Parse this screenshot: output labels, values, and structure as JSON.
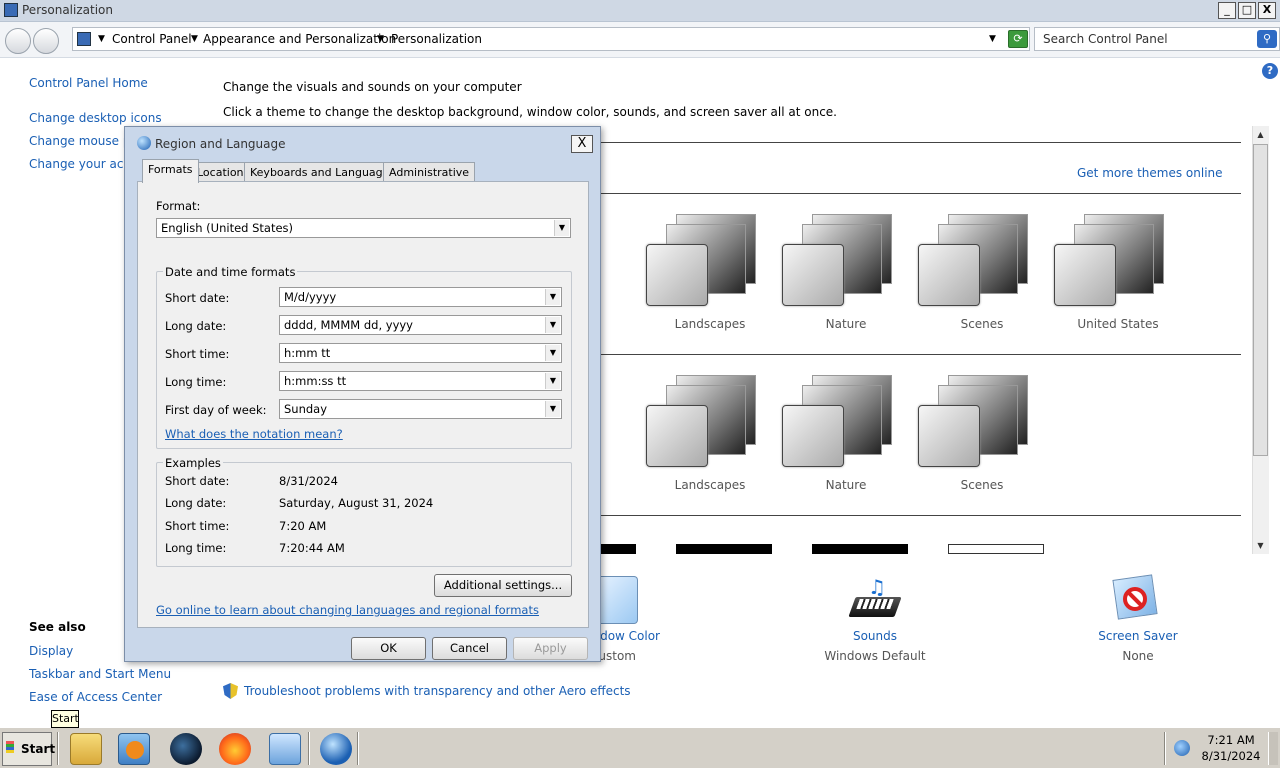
{
  "window": {
    "title": "Personalization",
    "minimize": "_",
    "maximize": "□",
    "close": "X"
  },
  "address": {
    "crumbs": [
      "Control Panel",
      "Appearance and Personalization",
      "Personalization"
    ],
    "search_placeholder": "Search Control Panel"
  },
  "sidebar": {
    "home": "Control Panel Home",
    "links": [
      "Change desktop icons",
      "Change mouse pointers",
      "Change your account picture"
    ],
    "see_also_title": "See also",
    "see_also": [
      "Display",
      "Taskbar and Start Menu",
      "Ease of Access Center"
    ]
  },
  "main": {
    "heading": "Change the visuals and sounds on your computer",
    "subheading": "Click a theme to change the desktop background, window color, sounds, and screen saver all at once.",
    "get_more_themes": "Get more themes online",
    "row1_themes": [
      "Landscapes",
      "Nature",
      "Scenes",
      "United States"
    ],
    "row2_themes": [
      "Landscapes",
      "Nature",
      "Scenes"
    ],
    "bottom": {
      "window_color_label": "Window Color",
      "window_color_value": "Custom",
      "sounds_label": "Sounds",
      "sounds_value": "Windows Default",
      "screensaver_label": "Screen Saver",
      "screensaver_value": "None"
    },
    "troubleshoot": "Troubleshoot problems with transparency and other Aero effects"
  },
  "dialog": {
    "title": "Region and Language",
    "close": "X",
    "tabs": [
      "Formats",
      "Location",
      "Keyboards and Languages",
      "Administrative"
    ],
    "format_label": "Format:",
    "format_value": "English (United States)",
    "dt_group": "Date and time formats",
    "fields": [
      {
        "label": "Short date:",
        "value": "M/d/yyyy"
      },
      {
        "label": "Long date:",
        "value": "dddd, MMMM dd, yyyy"
      },
      {
        "label": "Short time:",
        "value": "h:mm tt"
      },
      {
        "label": "Long time:",
        "value": "h:mm:ss tt"
      },
      {
        "label": "First day of week:",
        "value": "Sunday"
      }
    ],
    "notation_link": "What does the notation mean?",
    "examples_group": "Examples",
    "examples": [
      {
        "label": "Short date:",
        "value": "8/31/2024"
      },
      {
        "label": "Long date:",
        "value": "Saturday, August 31, 2024"
      },
      {
        "label": "Short time:",
        "value": "7:20 AM"
      },
      {
        "label": "Long time:",
        "value": "7:20:44 AM"
      }
    ],
    "additional_settings": "Additional settings...",
    "online_link": "Go online to learn about changing languages and regional formats",
    "ok": "OK",
    "cancel": "Cancel",
    "apply": "Apply"
  },
  "taskbar": {
    "start": "Start",
    "tooltip": "Start",
    "time": "7:21 AM",
    "date": "8/31/2024"
  }
}
